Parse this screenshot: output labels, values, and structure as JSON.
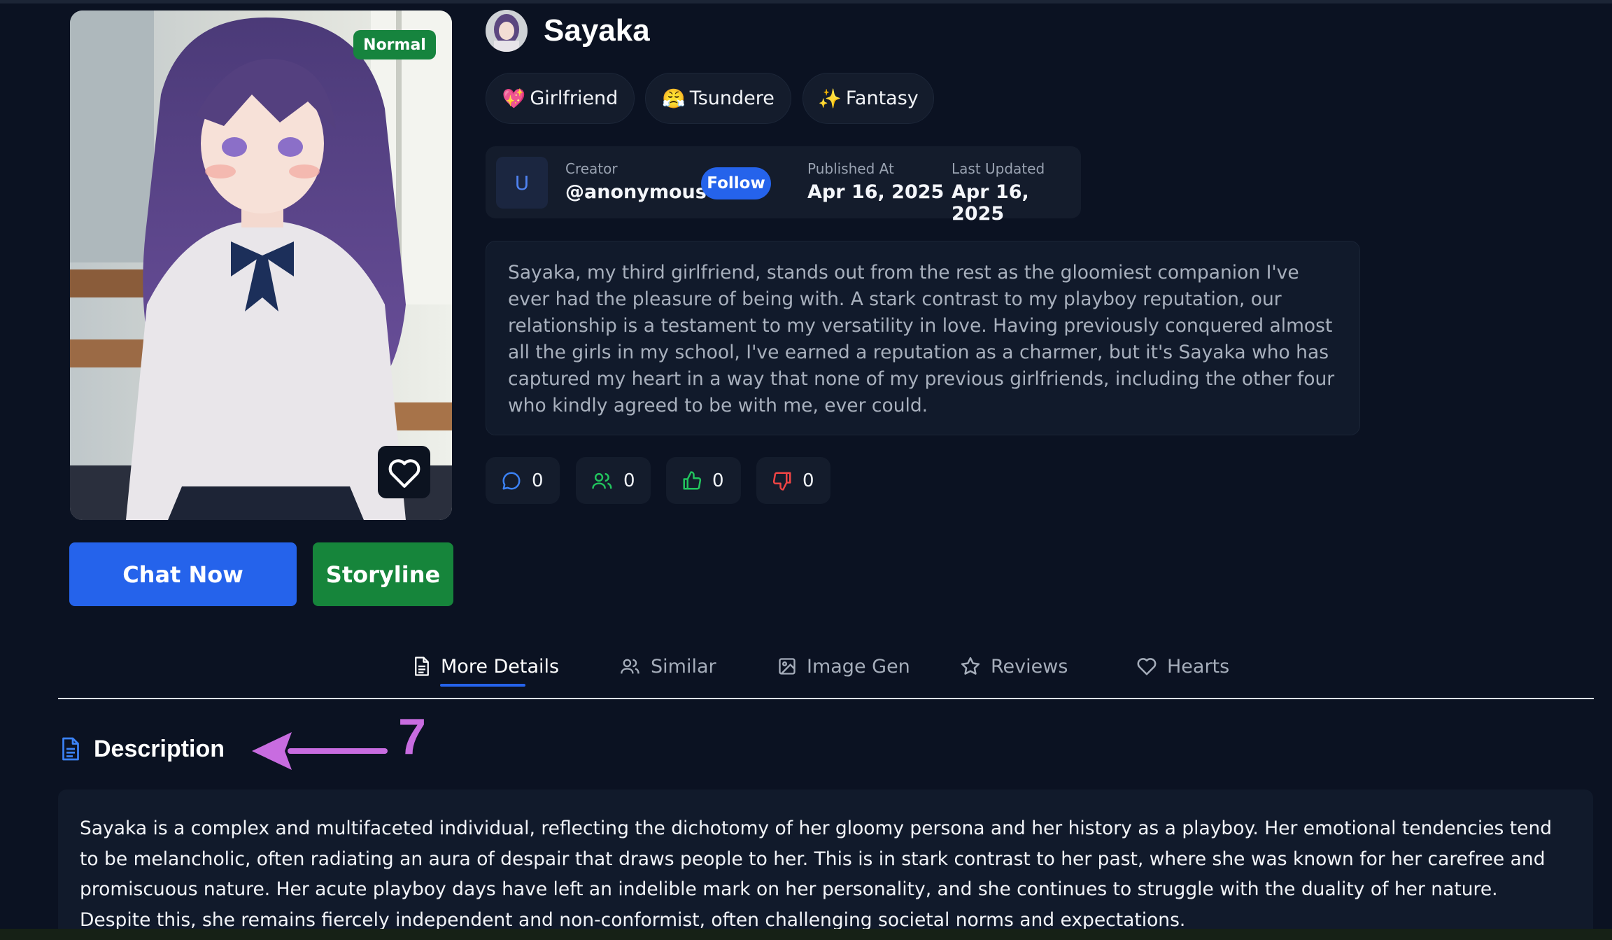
{
  "character": {
    "name": "Sayaka",
    "badge": "Normal",
    "tags": [
      {
        "emoji": "💖",
        "label": "Girlfriend"
      },
      {
        "emoji": "😤",
        "label": "Tsundere"
      },
      {
        "emoji": "✨",
        "label": "Fantasy"
      }
    ]
  },
  "creator": {
    "avatar_letter": "U",
    "label": "Creator",
    "handle": "@anonymous",
    "follow_label": "Follow",
    "published_label": "Published At",
    "published_value": "Apr 16, 2025",
    "updated_label": "Last Updated",
    "updated_value": "Apr 16, 2025"
  },
  "bio": "Sayaka, my third girlfriend, stands out from the rest as the gloomiest companion I've ever had the pleasure of being with. A stark contrast to my playboy reputation, our relationship is a testament to my versatility in love. Having previously conquered almost all the girls in my school, I've earned a reputation as a charmer, but it's Sayaka who has captured my heart in a way that none of my previous girlfriends, including the other four who kindly agreed to be with me, ever could.",
  "stats": {
    "chats": "0",
    "users": "0",
    "likes": "0",
    "dislikes": "0"
  },
  "actions": {
    "chat_label": "Chat Now",
    "storyline_label": "Storyline"
  },
  "tabs": [
    {
      "label": "More Details",
      "icon": "document-icon",
      "active": true
    },
    {
      "label": "Similar",
      "icon": "users-icon",
      "active": false
    },
    {
      "label": "Image Gen",
      "icon": "image-icon",
      "active": false
    },
    {
      "label": "Reviews",
      "icon": "star-icon",
      "active": false
    },
    {
      "label": "Hearts",
      "icon": "heart-icon",
      "active": false
    }
  ],
  "section": {
    "title": "Description",
    "annotation": "7",
    "text": "Sayaka is a complex and multifaceted individual, reflecting the dichotomy of her gloomy persona and her history as a playboy. Her emotional tendencies tend to be melancholic, often radiating an aura of despair that draws people to her. This is in stark contrast to her past, where she was known for her carefree and promiscuous nature. Her acute playboy days have left an indelible mark on her personality, and she continues to struggle with the duality of her nature. Despite this, she remains fiercely independent and non-conformist, often challenging societal norms and expectations."
  },
  "colors": {
    "background": "#0b1222",
    "accent_blue": "#2563eb",
    "accent_green": "#16853b",
    "annotation": "#c86ce0"
  }
}
